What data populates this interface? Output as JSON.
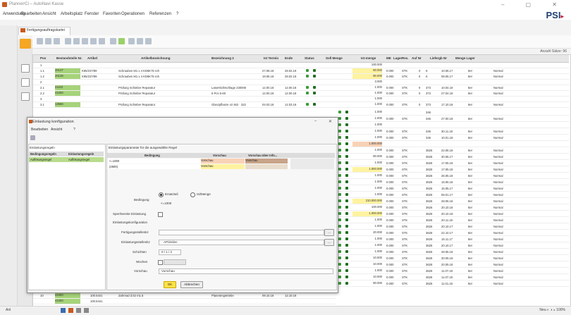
{
  "window": {
    "title": "Planner/Ci – AutoNavi Kasse",
    "controls": "– ▢ ✕"
  },
  "brand": {
    "name": "PSI",
    "suffix": "▸"
  },
  "menubar": [
    "Anwendung",
    "Bearbeiten",
    "Ansicht",
    "Arbeitsplatz",
    "Fenster",
    "Favoriten",
    "Operationen",
    "Referenzen",
    "?"
  ],
  "doc_tab": {
    "label": "Fertigungsauftragskartei"
  },
  "toolbar": {
    "right_text": "Anzahl Sätze: 96"
  },
  "grid": {
    "headers": [
      "Pos",
      "Bestandsteile Nr.",
      "Artikel",
      "Artikelbezeichnung",
      "Bezeichnung 2",
      "Ist Termin",
      "Ende",
      "Status",
      "Soll Menge",
      "Ist-menge",
      "ME",
      "Lager",
      "Res.",
      "Auf Nr",
      "Liefergb Nr",
      "Menge Lager"
    ],
    "rows": [
      {
        "pos": "1",
        "nr": "",
        "artikel": "",
        "bez": "",
        "bez2": "",
        "termin": "",
        "ende": "",
        "soll": "100.000",
        "ist": "",
        "me": "",
        "lager": "",
        "res": "",
        "auf": "",
        "lief": "",
        "mlag": ""
      },
      {
        "pos": "1.1",
        "nr": "20137",
        "artikel": "K95/237/89",
        "bez": "Schrauben M1 x 4 KD6K75 roh",
        "bez2": "",
        "termin": "27.08.18",
        "ende": "28.02.19",
        "soll": "80.000",
        "ist": "0.000",
        "me": "STK",
        "lager": "0",
        "res": "K",
        "auf": "10.06.17",
        "lief": "8er",
        "mlag": "Normal"
      },
      {
        "pos": "1.2",
        "nr": "20138",
        "artikel": "K95/237/89",
        "bez": "Schrauben M1 x 4 KD6K75 roh",
        "bez2": "",
        "termin": "19.06.18",
        "ende": "28.02.19",
        "soll": "80.000",
        "ist": "0.000",
        "me": "STK",
        "lager": "0",
        "res": "K",
        "auf": "08.05.17",
        "lief": "8er",
        "mlag": "Normal"
      },
      {
        "pos": "2",
        "nr": "",
        "artikel": "",
        "bez": "",
        "bez2": "",
        "termin": "",
        "ende": "",
        "soll": "3.000",
        "ist": "",
        "me": "",
        "lager": "",
        "res": "",
        "auf": "",
        "lief": "",
        "mlag": ""
      },
      {
        "pos": "2.1",
        "nr": "21102",
        "artikel": "",
        "bez": "Prüfung Schieber Reparatur",
        "bez2": "Lasertrichtschlage 230000",
        "termin": "12.00.18",
        "ende": "12.00.18",
        "soll": "1.000",
        "ist": "0.000",
        "me": "STK",
        "lager": "0",
        "res": "373",
        "auf": "10.04.18",
        "lief": "8er",
        "mlag": "Normal"
      },
      {
        "pos": "2.2",
        "nr": "41000",
        "artikel": "",
        "bez": "Prüfung Schieber Reparatur",
        "bez2": "5 Pcs 5-60",
        "termin": "12.00.18",
        "ende": "12.00.18",
        "soll": "1.000",
        "ist": "0.000",
        "me": "STK",
        "lager": "0",
        "res": "373",
        "auf": "27.04.18",
        "lief": "8er",
        "mlag": "Normal"
      },
      {
        "pos": "3",
        "nr": "",
        "artikel": "",
        "bez": "",
        "bez2": "",
        "termin": "",
        "ende": "",
        "soll": "1.000",
        "ist": "",
        "me": "",
        "lager": "",
        "res": "",
        "auf": "",
        "lief": "",
        "mlag": ""
      },
      {
        "pos": "3.1",
        "nr": "13566",
        "artikel": "",
        "bez": "Prüfung Schieber Reparatur",
        "bez2": "Glanzpflanze v2 462 · 322",
        "termin": "04.03.18",
        "ende": "12.03.18",
        "soll": "1.000",
        "ist": "0.000",
        "me": "STK",
        "lager": "0",
        "res": "373",
        "auf": "17.10.18",
        "lief": "8er",
        "mlag": "Normal"
      }
    ],
    "right_rows": [
      {
        "soll": "1.000",
        "ist": "",
        "me": "",
        "res": "346",
        "auf": "",
        "lief": "",
        "mlag": ""
      },
      {
        "soll": "1.000",
        "ist": "0.000",
        "me": "STK",
        "res": "346",
        "auf": "27.00.18",
        "lief": "8er",
        "mlag": "Normal"
      },
      {
        "soll": "1.000",
        "ist": "",
        "me": "",
        "res": "",
        "auf": "",
        "lief": "",
        "mlag": ""
      },
      {
        "soll": "1.000",
        "ist": "0.000",
        "me": "STK",
        "res": "346",
        "auf": "30.11.18",
        "lief": "8er",
        "mlag": "Normal"
      },
      {
        "soll": "1.000",
        "ist": "0.000",
        "me": "STK",
        "res": "346",
        "auf": "10.01.18",
        "lief": "8er",
        "mlag": "Normal"
      },
      {
        "soll": "1.000.000",
        "ist": "",
        "me": "",
        "res": "",
        "auf": "",
        "lief": "",
        "mlag": ""
      },
      {
        "soll": "1.000",
        "ist": "0.000",
        "me": "STK",
        "res": "3626",
        "auf": "22.06.18",
        "lief": "8er",
        "mlag": "Normal"
      },
      {
        "soll": "80.000",
        "ist": "0.000",
        "me": "STK",
        "res": "3626",
        "auf": "30.06.17",
        "lief": "8er",
        "mlag": "Normal"
      },
      {
        "soll": "1.000",
        "ist": "0.000",
        "me": "STK",
        "res": "3626",
        "auf": "17.05.18",
        "lief": "8er",
        "mlag": "Normal"
      },
      {
        "soll": "1.000.000",
        "ist": "0.000",
        "me": "STK",
        "res": "3626",
        "auf": "17.05.18",
        "lief": "8er",
        "mlag": "Normal"
      },
      {
        "soll": "1.000",
        "ist": "0.000",
        "me": "STK",
        "res": "3626",
        "auf": "26.05.18",
        "lief": "8er",
        "mlag": "Normal"
      },
      {
        "soll": "1.000",
        "ist": "0.000",
        "me": "STK",
        "res": "3626",
        "auf": "15.05.18",
        "lief": "8er",
        "mlag": "Normal"
      },
      {
        "soll": "1.000",
        "ist": "0.000",
        "me": "STK",
        "res": "3626",
        "auf": "15.05.17",
        "lief": "8er",
        "mlag": "Normal"
      },
      {
        "soll": "1.000",
        "ist": "0.000",
        "me": "STK",
        "res": "3626",
        "auf": "08.01.17",
        "lief": "8er",
        "mlag": "Normal"
      },
      {
        "soll": "210.000.000",
        "ist": "0.000",
        "me": "STK",
        "res": "3626",
        "auf": "28.06.18",
        "lief": "8er",
        "mlag": "Normal"
      },
      {
        "soll": "100.000",
        "ist": "0.000",
        "me": "STK",
        "res": "3626",
        "auf": "20.10.18",
        "lief": "8er",
        "mlag": "Normal"
      },
      {
        "soll": "1.000.000",
        "ist": "0.000",
        "me": "STK",
        "res": "3626",
        "auf": "20.10.18",
        "lief": "8er",
        "mlag": "Normal"
      },
      {
        "soll": "1.000",
        "ist": "0.000",
        "me": "STK",
        "res": "3626",
        "auf": "20.11.18",
        "lief": "8er",
        "mlag": "Normal"
      },
      {
        "soll": "1.000",
        "ist": "0.000",
        "me": "STK",
        "res": "3626",
        "auf": "20.10.17",
        "lief": "8er",
        "mlag": "Normal"
      },
      {
        "soll": "20.000",
        "ist": "0.000",
        "me": "STK",
        "res": "3626",
        "auf": "22.10.17",
        "lief": "8er",
        "mlag": "Normal"
      },
      {
        "soll": "1.000",
        "ist": "0.000",
        "me": "STK",
        "res": "3626",
        "auf": "15.11.17",
        "lief": "8er",
        "mlag": "Normal"
      },
      {
        "soll": "1.000",
        "ist": "0.000",
        "me": "STK",
        "res": "3626",
        "auf": "20.10.17",
        "lief": "8er",
        "mlag": "Normal"
      },
      {
        "soll": "1.000",
        "ist": "0.000",
        "me": "STK",
        "res": "3626",
        "auf": "28.05.18",
        "lief": "8er",
        "mlag": "Normal"
      },
      {
        "soll": "10.000",
        "ist": "0.000",
        "me": "STK",
        "res": "3626",
        "auf": "30.05.18",
        "lief": "8er",
        "mlag": "Normal"
      },
      {
        "soll": "10.000",
        "ist": "0.000",
        "me": "STK",
        "res": "3626",
        "auf": "20.05.18",
        "lief": "8er",
        "mlag": "Normal"
      },
      {
        "soll": "1.000",
        "ist": "0.000",
        "me": "STK",
        "res": "3626",
        "auf": "11.07.18",
        "lief": "8er",
        "mlag": "Normal"
      },
      {
        "soll": "10.000",
        "ist": "0.000",
        "me": "STK",
        "res": "3626",
        "auf": "11.07.18",
        "lief": "8er",
        "mlag": "Normal"
      },
      {
        "soll": "80.000",
        "ist": "0.000",
        "me": "STK",
        "res": "3626",
        "auf": "11.01.18",
        "lief": "8er",
        "mlag": "Normal"
      }
    ],
    "bottom_rows": [
      {
        "pos": "10",
        "nr": "41000",
        "artikel": "100.5441",
        "bez": "Zahnrad d.52 m1.5",
        "bez2": "Planetengetriebe",
        "termin": "09.10.18",
        "ende": "12.10.18"
      },
      {
        "pos": "",
        "nr": "41000",
        "artikel": "100.5441",
        "bez": "",
        "bez2": "",
        "termin": "",
        "ende": ""
      }
    ]
  },
  "dialog": {
    "title": "Einlastung konfiguration",
    "menu": [
      "Bearbeiten",
      "Ansicht",
      "?"
    ],
    "left_title": "Einlastungsregeln",
    "left_headers": [
      "Bedingungsregeln",
      "Einlastungsregeln"
    ],
    "left_selected": [
      "Auflösungsregel",
      "Auflösungsregel"
    ],
    "right_title": "Einlastungsparameter für die ausgewählte Regel",
    "table_headers": [
      "Bedingung",
      "Vorschau",
      "Vorschau über Info..."
    ],
    "table_rows": [
      {
        "bed": "<=1000",
        "vor": "Vorschau",
        "info": "Vorschau"
      },
      {
        "bed": "(2500)",
        "vor": "Vorschau",
        "info": ""
      }
    ],
    "bedingung_label": "Bedingung",
    "radio1": "Ersatzteil",
    "radio2": "Ist/Menge",
    "bedingung_value": "<=1000",
    "sperr_label": "Sperrbereite Einlastung",
    "einlast_label": "Einlastungskonfiguration",
    "f1_label": "Fertigungsstellenkz",
    "f2_label": "Einlastungsstellenkz",
    "f2_value": "AP/Zeilen",
    "f3_label": "Schichten",
    "f3_value": "0 / 1 / 2",
    "f4_label": "Wochen",
    "f5_label": "Vorschau",
    "f5_value": "Vorschau",
    "ok": "OK",
    "cancel": "Abbrechen"
  },
  "statusbar": {
    "left": "Anl",
    "right": "Neu  ◐  ◑  ◒  100%"
  },
  "colors": {
    "green": "#a6d37a",
    "yellow": "#fff3a0",
    "peach": "#f9d2b6",
    "dark_peach": "#c8a489",
    "brand": "#1f3f73"
  }
}
